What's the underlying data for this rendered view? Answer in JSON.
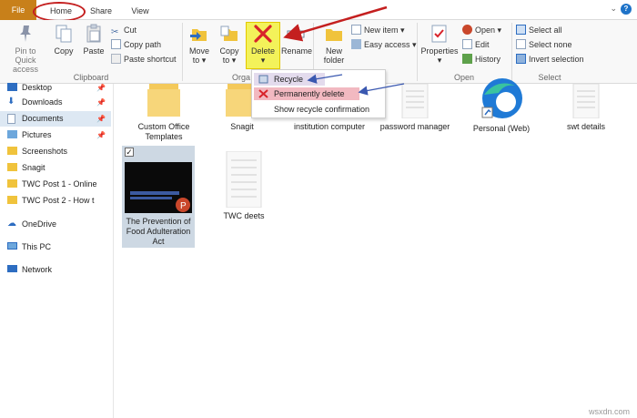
{
  "tabs": {
    "file": "File",
    "home": "Home",
    "share": "Share",
    "view": "View"
  },
  "clipboard": {
    "pin": "Pin to Quick access",
    "copy": "Copy",
    "paste": "Paste",
    "cut": "Cut",
    "copy_path": "Copy path",
    "paste_shortcut": "Paste shortcut",
    "label": "Clipboard"
  },
  "organize": {
    "move_to": "Move to",
    "copy_to": "Copy to",
    "delete": "Delete",
    "rename": "Rename",
    "label": "Orga"
  },
  "new": {
    "new_item": "New item",
    "easy_access": "Easy access",
    "new_folder": "New folder"
  },
  "open": {
    "properties": "Properties",
    "open": "Open",
    "edit": "Edit",
    "history": "History",
    "label": "Open"
  },
  "select": {
    "select_all": "Select all",
    "select_none": "Select none",
    "invert": "Invert selection",
    "label": "Select"
  },
  "delete_menu": {
    "recycle": "Recycle",
    "permanently": "Permanently delete",
    "confirm": "Show recycle confirmation"
  },
  "nav": {
    "desktop": "Desktop",
    "downloads": "Downloads",
    "documents": "Documents",
    "pictures": "Pictures",
    "screenshots": "Screenshots",
    "snagit": "Snagit",
    "twc1": "TWC Post 1 - Online",
    "twc2": "TWC Post 2 - How t",
    "onedrive": "OneDrive",
    "thispc": "This PC",
    "network": "Network"
  },
  "files": {
    "custom_office": "Custom Office Templates",
    "snagit": "Snagit",
    "institution": "institution computer",
    "password": "password manager",
    "personal_web": "Personal (Web)",
    "swt": "swt details",
    "ppt": "The Prevention of Food Adulteration Act",
    "twc_deets": "TWC deets"
  },
  "watermark": "wsxdn.com",
  "colors": {
    "file_tab": "#c8801a",
    "highlight": "#f3f25a",
    "annotation": "#c41f1f",
    "selection": "#cdd8e3"
  }
}
